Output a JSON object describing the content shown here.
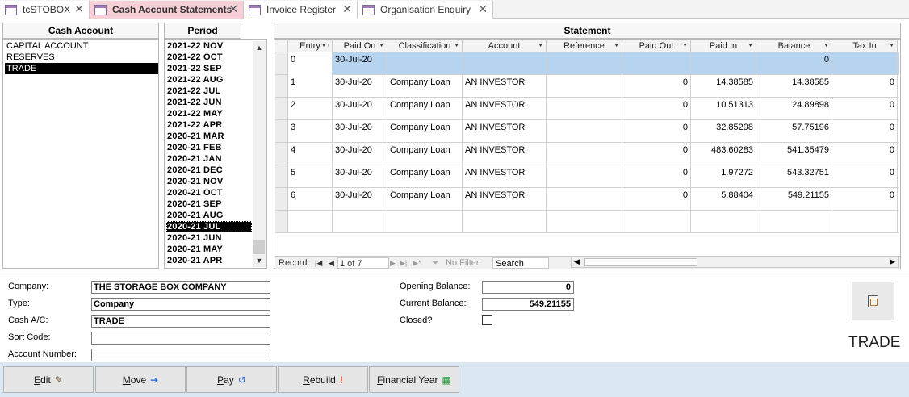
{
  "tabs": [
    {
      "label": "tcSTOBOX"
    },
    {
      "label": "Cash Account Statements"
    },
    {
      "label": "Invoice Register"
    },
    {
      "label": "Organisation Enquiry"
    }
  ],
  "cash_account": {
    "header": "Cash Account",
    "items": [
      "CAPITAL ACCOUNT",
      "RESERVES",
      "TRADE"
    ],
    "selected": "TRADE"
  },
  "period": {
    "header": "Period",
    "items": [
      "2021-22 NOV",
      "2021-22 OCT",
      "2021-22 SEP",
      "2021-22 AUG",
      "2021-22 JUL",
      "2021-22 JUN",
      "2021-22 MAY",
      "2021-22 APR",
      "2020-21 MAR",
      "2020-21 FEB",
      "2020-21 JAN",
      "2020-21 DEC",
      "2020-21 NOV",
      "2020-21 OCT",
      "2020-21 SEP",
      "2020-21 AUG",
      "2020-21 JUL",
      "2020-21 JUN",
      "2020-21 MAY",
      "2020-21 APR"
    ],
    "selected": "2020-21 JUL",
    "scroll_up": "▲",
    "scroll_down": "▼"
  },
  "statement": {
    "header": "Statement",
    "columns": [
      "Entry",
      "Paid On",
      "Classification",
      "Account",
      "Reference",
      "Paid Out",
      "Paid In",
      "Balance",
      "Tax In"
    ],
    "rows": [
      {
        "entry": "0",
        "paid_on": "30-Jul-20",
        "classification": "",
        "account": "",
        "reference": "",
        "paid_out": "",
        "paid_in": "",
        "balance": "0",
        "tax_in": ""
      },
      {
        "entry": "1",
        "paid_on": "30-Jul-20",
        "classification": "Company Loan",
        "account": "AN INVESTOR",
        "reference": "",
        "paid_out": "0",
        "paid_in": "14.38585",
        "balance": "14.38585",
        "tax_in": "0"
      },
      {
        "entry": "2",
        "paid_on": "30-Jul-20",
        "classification": "Company Loan",
        "account": "AN INVESTOR",
        "reference": "",
        "paid_out": "0",
        "paid_in": "10.51313",
        "balance": "24.89898",
        "tax_in": "0"
      },
      {
        "entry": "3",
        "paid_on": "30-Jul-20",
        "classification": "Company Loan",
        "account": "AN INVESTOR",
        "reference": "",
        "paid_out": "0",
        "paid_in": "32.85298",
        "balance": "57.75196",
        "tax_in": "0"
      },
      {
        "entry": "4",
        "paid_on": "30-Jul-20",
        "classification": "Company Loan",
        "account": "AN INVESTOR",
        "reference": "",
        "paid_out": "0",
        "paid_in": "483.60283",
        "balance": "541.35479",
        "tax_in": "0"
      },
      {
        "entry": "5",
        "paid_on": "30-Jul-20",
        "classification": "Company Loan",
        "account": "AN INVESTOR",
        "reference": "",
        "paid_out": "0",
        "paid_in": "1.97272",
        "balance": "543.32751",
        "tax_in": "0"
      },
      {
        "entry": "6",
        "paid_on": "30-Jul-20",
        "classification": "Company Loan",
        "account": "AN INVESTOR",
        "reference": "",
        "paid_out": "0",
        "paid_in": "5.88404",
        "balance": "549.21155",
        "tax_in": "0"
      }
    ],
    "nav": {
      "record_label": "Record:",
      "first": "|◀",
      "prev": "◀",
      "record_value": "1 of 7",
      "next": "▶",
      "last": "▶|",
      "new": "▶*",
      "filter_label": "No Filter",
      "search_label": "Search",
      "scroll_left": "◀",
      "scroll_right": "▶"
    }
  },
  "details": {
    "company_label": "Company:",
    "company_value": "THE STORAGE BOX COMPANY",
    "type_label": "Type:",
    "type_value": "Company",
    "cash_ac_label": "Cash A/C:",
    "cash_ac_value": "TRADE",
    "sort_code_label": "Sort Code:",
    "sort_code_value": "",
    "account_number_label": "Account Number:",
    "account_number_value": "",
    "opening_balance_label": "Opening Balance:",
    "opening_balance_value": "0",
    "current_balance_label": "Current Balance:",
    "current_balance_value": "549.21155",
    "closed_label": "Closed?",
    "account_badge": "TRADE"
  },
  "footer_buttons": [
    {
      "ul": "E",
      "rest": "dit",
      "icon": "✎"
    },
    {
      "ul": "M",
      "rest": "ove",
      "icon": "➔"
    },
    {
      "ul": "P",
      "rest": "ay",
      "icon": "↺"
    },
    {
      "ul": "R",
      "rest": "ebuild",
      "icon": "!"
    },
    {
      "ul": "F",
      "rest": "inancial Year",
      "icon": "▦"
    }
  ],
  "colors": {
    "active_tab": "#f6d0d6",
    "selected_row": "#b6d3f0",
    "footer_bg": "#dbe7f2"
  }
}
